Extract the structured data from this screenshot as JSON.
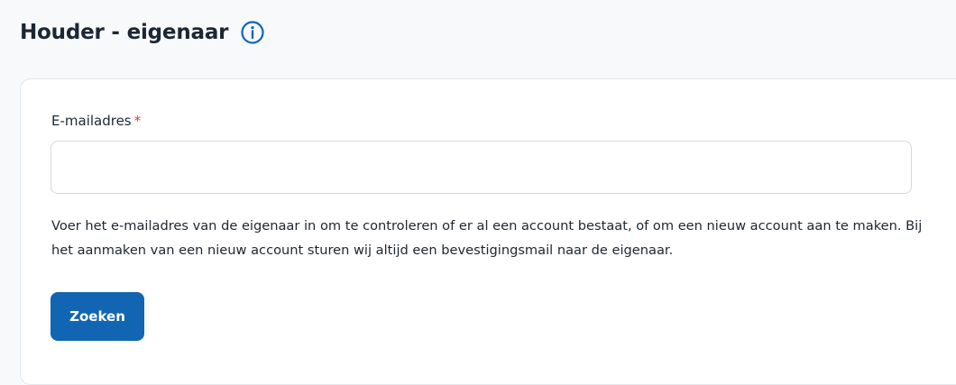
{
  "header": {
    "title": "Houder - eigenaar",
    "info_icon": "info-circle-icon"
  },
  "form": {
    "email_label": "E-mailadres",
    "required_marker": "*",
    "email_value": "",
    "email_placeholder": "",
    "help_text": "Voer het e-mailadres van de eigenaar in om te controleren of er al een account bestaat, of om een nieuw account aan te maken. Bij het aanmaken van een nieuw account sturen wij altijd een bevestigingsmail naar de eigenaar.",
    "search_label": "Zoeken"
  },
  "colors": {
    "accent": "#1265b3",
    "required": "#d93a3a",
    "background": "#f7f9fb",
    "text": "#1c2733"
  }
}
